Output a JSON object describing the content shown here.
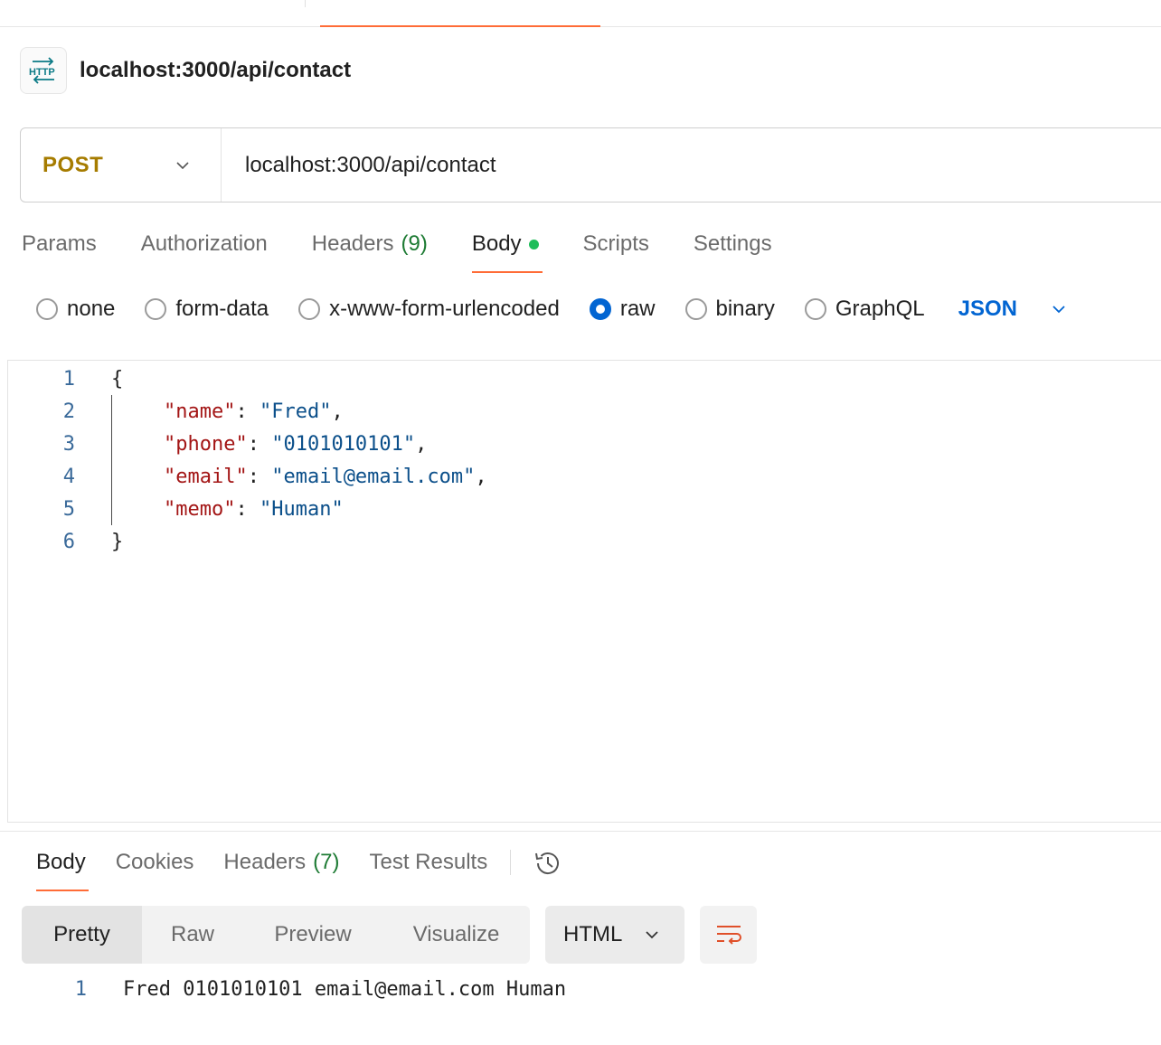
{
  "request": {
    "title": "localhost:3000/api/contact",
    "method": "POST",
    "url": "localhost:3000/api/contact",
    "icon": "http-icon",
    "accent_color": "#ff6c37"
  },
  "request_tabs": [
    {
      "label": "Params",
      "count": ""
    },
    {
      "label": "Authorization",
      "count": ""
    },
    {
      "label": "Headers",
      "count": "(9)"
    },
    {
      "label": "Body",
      "count": "",
      "active": true
    },
    {
      "label": "Scripts",
      "count": ""
    },
    {
      "label": "Settings",
      "count": ""
    }
  ],
  "body_types": {
    "options": [
      "none",
      "form-data",
      "x-www-form-urlencoded",
      "raw",
      "binary",
      "GraphQL"
    ],
    "selected": "raw",
    "language": "JSON"
  },
  "editor": {
    "line_numbers": [
      "1",
      "2",
      "3",
      "4",
      "5",
      "6"
    ],
    "lines": [
      {
        "open": "{"
      },
      {
        "key": "\"name\"",
        "value": "\"Fred\"",
        "trail": ","
      },
      {
        "key": "\"phone\"",
        "value": "\"0101010101\"",
        "trail": ","
      },
      {
        "key": "\"email\"",
        "value": "\"email@email.com\"",
        "trail": ","
      },
      {
        "key": "\"memo\"",
        "value": "\"Human\"",
        "trail": ""
      },
      {
        "close": "}"
      }
    ],
    "colon": ":"
  },
  "response_tabs": [
    {
      "label": "Body",
      "count": "",
      "active": true
    },
    {
      "label": "Cookies",
      "count": ""
    },
    {
      "label": "Headers",
      "count": "(7)"
    },
    {
      "label": "Test Results",
      "count": ""
    }
  ],
  "response_view": {
    "modes": [
      "Pretty",
      "Raw",
      "Preview",
      "Visualize"
    ],
    "selected": "Pretty",
    "format": "HTML"
  },
  "response_body": {
    "line_number": "1",
    "text": "Fred 0101010101 email@email.com Human"
  }
}
